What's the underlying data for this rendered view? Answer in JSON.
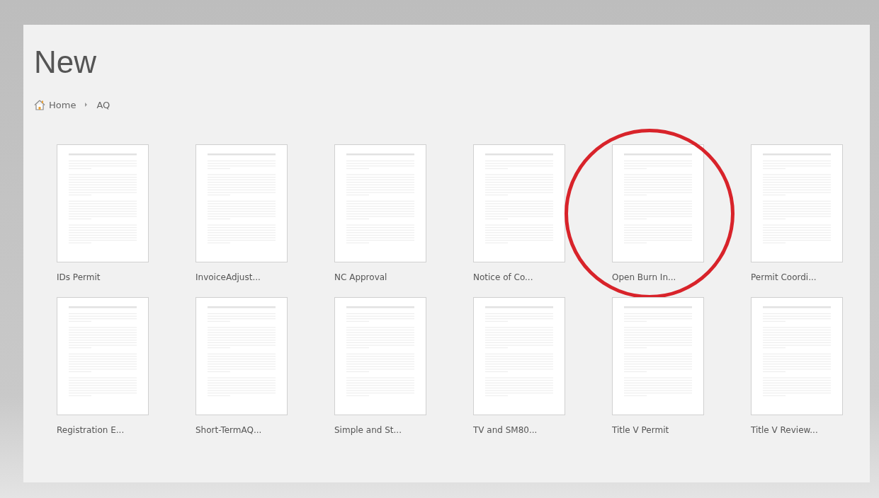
{
  "title": "New",
  "breadcrumb": [
    {
      "label": "Home",
      "kind": "home"
    },
    {
      "label": "AQ",
      "kind": "folder"
    }
  ],
  "templates": [
    {
      "name": "IDs Permit",
      "circled": false
    },
    {
      "name": "InvoiceAdjust...",
      "circled": false
    },
    {
      "name": "NC Approval",
      "circled": false
    },
    {
      "name": "Notice of Co...",
      "circled": false
    },
    {
      "name": "Open Burn In...",
      "circled": true
    },
    {
      "name": "Permit Coordi...",
      "circled": false
    },
    {
      "name": "Registration E...",
      "circled": false
    },
    {
      "name": "Short-TermAQ...",
      "circled": false
    },
    {
      "name": "Simple and St...",
      "circled": false
    },
    {
      "name": "TV and SM80...",
      "circled": false
    },
    {
      "name": "Title V Permit",
      "circled": false
    },
    {
      "name": "Title V Review...",
      "circled": false
    }
  ]
}
